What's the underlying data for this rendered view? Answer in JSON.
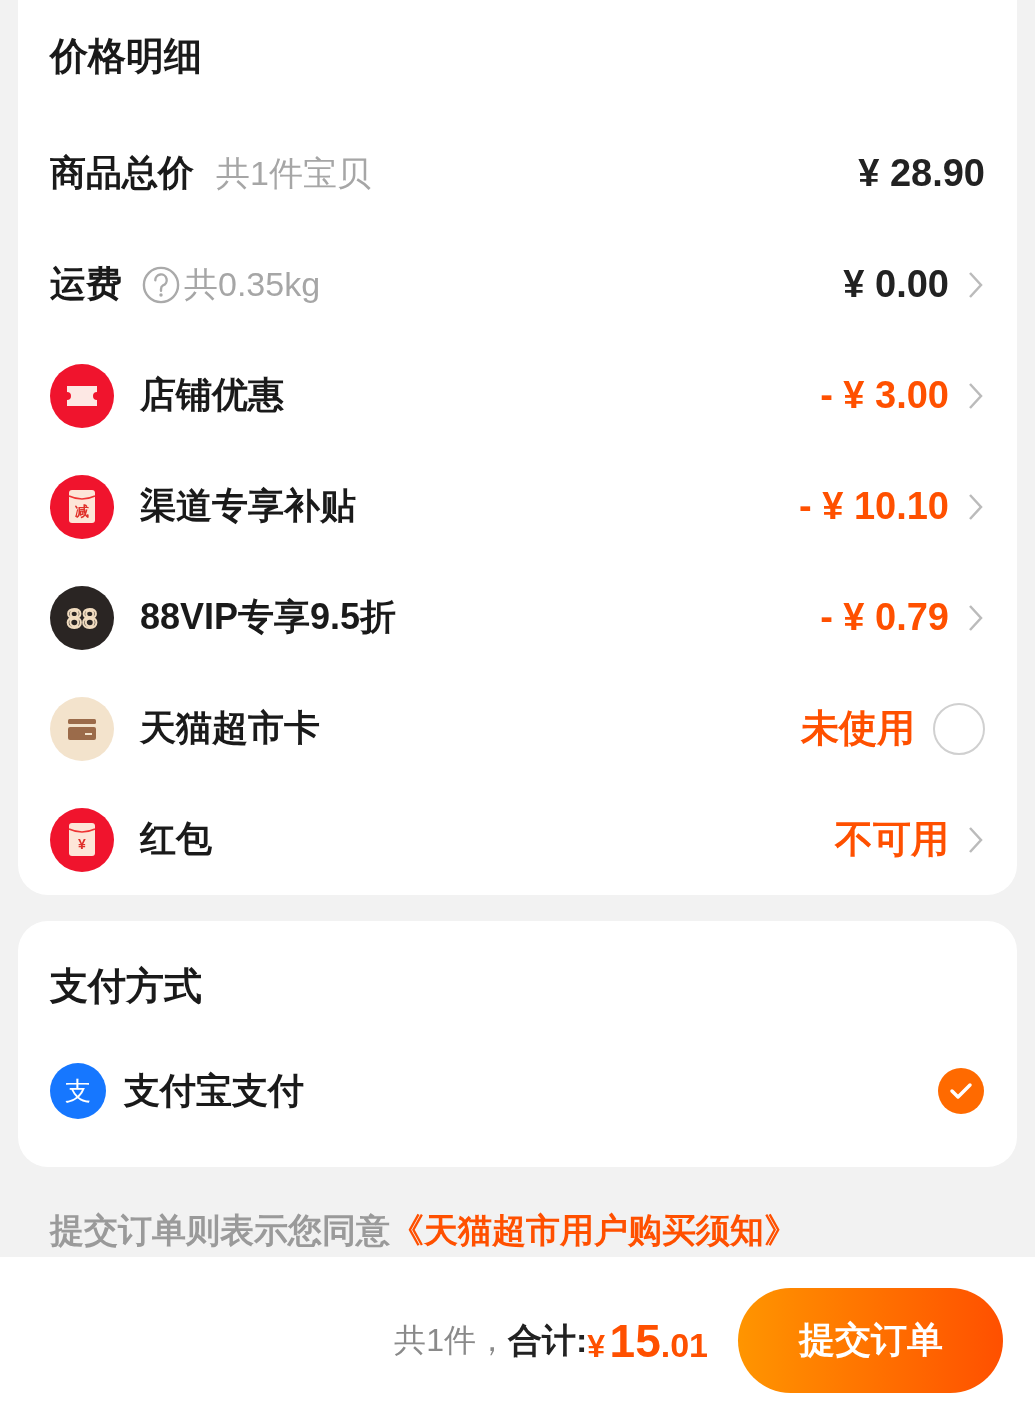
{
  "price_card": {
    "title": "价格明细",
    "rows": [
      {
        "kind": "text",
        "label": "商品总价",
        "note": "共1件宝贝",
        "help": false,
        "amount": "¥ 28.90",
        "highlight": false,
        "arrow": false
      },
      {
        "kind": "text",
        "label": "运费",
        "note": "共0.35kg",
        "help": true,
        "amount": "¥ 0.00",
        "highlight": false,
        "arrow": true
      },
      {
        "kind": "ticket",
        "label": "店铺优惠",
        "amount": "- ¥ 3.00",
        "highlight": true,
        "arrow": true
      },
      {
        "kind": "envelope",
        "icon_text": "减",
        "label": "渠道专享补贴",
        "amount": "- ¥ 10.10",
        "highlight": true,
        "arrow": true
      },
      {
        "kind": "vip",
        "icon_text": "88",
        "label": "88VIP专享9.5折",
        "amount": "- ¥ 0.79",
        "highlight": true,
        "arrow": true
      },
      {
        "kind": "card",
        "label": "天猫超市卡",
        "amount": "未使用",
        "highlight": true,
        "arrow": false,
        "checked": false
      },
      {
        "kind": "envelope",
        "icon_text": "¥",
        "label": "红包",
        "amount": "不可用",
        "highlight": true,
        "arrow": true
      }
    ]
  },
  "payment_card": {
    "title": "支付方式",
    "methods": [
      {
        "icon_text": "支",
        "label": "支付宝支付",
        "selected": true
      }
    ]
  },
  "agreement": {
    "text": "提交订单则表示您同意",
    "link": "《天猫超市用户购买须知》"
  },
  "footer": {
    "count": "共1件，",
    "total_label": "合计:",
    "currency": "¥",
    "total_integer": "15",
    "total_decimal": ".01",
    "submit": "提交订单"
  }
}
